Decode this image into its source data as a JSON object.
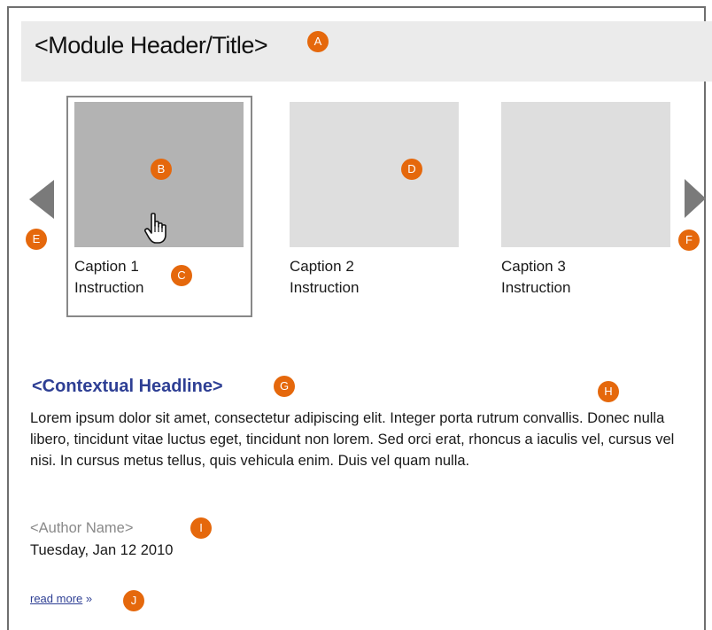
{
  "module": {
    "title": "<Module Header/Title>"
  },
  "carousel": {
    "items": [
      {
        "caption": "Caption 1",
        "instruction": "Instruction",
        "state": "selected"
      },
      {
        "caption": "Caption 2",
        "instruction": "Instruction",
        "state": "idle"
      },
      {
        "caption": "Caption 3",
        "instruction": "Instruction",
        "state": "idle"
      }
    ],
    "prev_icon": "triangle-left",
    "next_icon": "triangle-right",
    "cursor_icon": "hand-pointer"
  },
  "article": {
    "headline": "<Contextual Headline>",
    "body": "Lorem ipsum dolor sit amet, consectetur adipiscing elit. Integer porta rutrum convallis. Donec nulla libero, tincidunt vitae luctus eget, tincidunt non lorem. Sed orci erat, rhoncus a iaculis vel, cursus vel nisi. In cursus metus tellus, quis vehicula enim. Duis vel quam nulla.",
    "author": "<Author Name>",
    "date": "Tuesday, Jan 12 2010",
    "read_more": "read more",
    "read_more_suffix": "»"
  },
  "annotations": {
    "a": "A",
    "b": "B",
    "c": "C",
    "d": "D",
    "e": "E",
    "f": "F",
    "g": "G",
    "h": "H",
    "i": "I",
    "j": "J"
  },
  "colors": {
    "badge": "#e5680c",
    "headline": "#2e3f94",
    "header_bg": "#ebebeb",
    "thumb_selected": "#b3b3b3",
    "thumb_idle": "#dedede",
    "arrow": "#7a7a7a"
  }
}
